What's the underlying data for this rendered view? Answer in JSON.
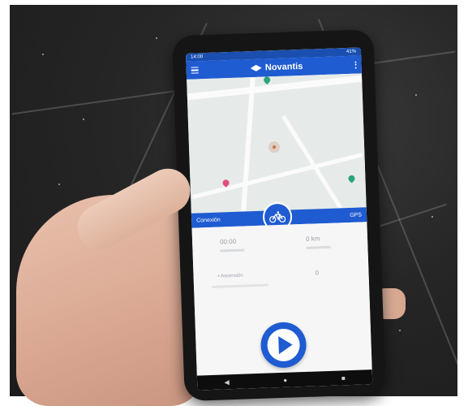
{
  "status_bar": {
    "time": "14:00",
    "battery": "41%"
  },
  "app_bar": {
    "brand": "Novantis",
    "menu_icon": "hamburger-icon",
    "overflow_icon": "kebab-icon"
  },
  "mode_bar": {
    "left_label": "Conexión",
    "right_label": "GPS",
    "center_icon": "bicycle-icon"
  },
  "stats": {
    "time_value": "00:00",
    "distance_value": "0 km",
    "left_bottom_label": "• Ascensión",
    "right_bottom_value": "0"
  },
  "controls": {
    "primary_action_icon": "play-icon"
  },
  "nav": {
    "back": "◀",
    "home": "●",
    "recent": "■"
  }
}
